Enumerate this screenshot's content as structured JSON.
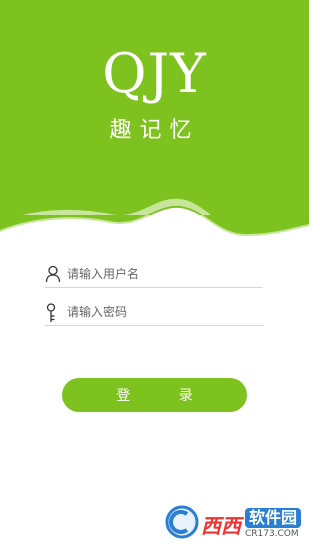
{
  "app": {
    "logo": "QJY",
    "subtitle": "趣记忆"
  },
  "form": {
    "username_placeholder": "请输入用户名",
    "password_placeholder": "请输入密码"
  },
  "buttons": {
    "login_label": "登 录"
  },
  "watermark": {
    "brand": "西西",
    "site": "软件园",
    "url": "CR173.COM"
  },
  "colors": {
    "accent": "#7dc21e",
    "accent_light": "#c8e59c"
  }
}
